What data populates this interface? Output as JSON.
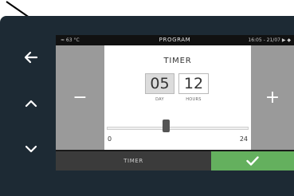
{
  "screen": {
    "title": "PROGRAM",
    "status_left": "≈ 63 °C",
    "status_right": "16:05 - 21/07  ▶ ◆"
  },
  "timer": {
    "heading": "TIMER",
    "day_value": "05",
    "day_label": "DAY",
    "hours_value": "12",
    "hours_label": "HOURS"
  },
  "slider": {
    "min": "0",
    "max": "24",
    "value": 12
  },
  "side": {
    "minus": "−",
    "plus": "+"
  },
  "bottom": {
    "tab_label": "TIMER"
  },
  "colors": {
    "bezel": "#1d2a34",
    "confirm": "#64b05e",
    "side_panel": "#9a9a9a"
  },
  "icons": {
    "back": "arrow-left-icon",
    "up": "chevron-up-icon",
    "down": "chevron-down-icon",
    "confirm": "check-icon"
  }
}
